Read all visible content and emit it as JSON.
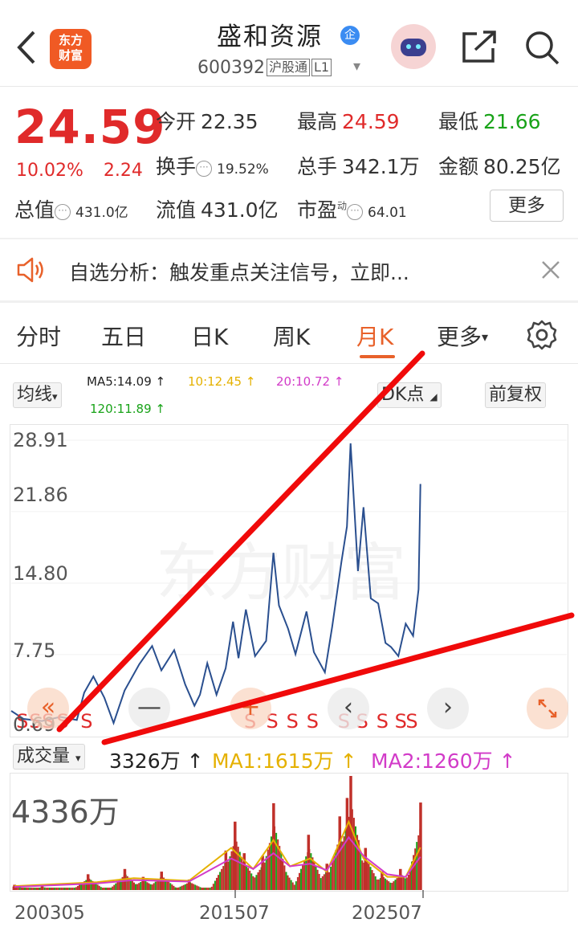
{
  "header": {
    "app_logo": "东方财富",
    "stock_name": "盛和资源",
    "badge": "企",
    "stock_code": "600392",
    "tag_connect": "沪股通",
    "tag_level": "L1",
    "icons": [
      "back-icon",
      "robot-icon",
      "share-icon",
      "search-icon"
    ]
  },
  "quote": {
    "price": "24.59",
    "change_pct": "10.02%",
    "change_abs": "2.24",
    "open_label": "今开",
    "open": "22.35",
    "high_label": "最高",
    "high": "24.59",
    "low_label": "最低",
    "low": "21.66",
    "turnover_label": "换手",
    "turnover": "19.52%",
    "volume_label": "总手",
    "volume": "342.1万",
    "amount_label": "金额",
    "amount": "80.25亿",
    "mktcap_label": "总值",
    "mktcap": "431.0亿",
    "float_label": "流值",
    "float": "431.0亿",
    "pe_label": "市盈",
    "pe_sup": "动",
    "pe": "64.01",
    "more_button": "更多"
  },
  "notice": {
    "text": "自选分析：触发重点关注信号，立即..."
  },
  "tabs": [
    "分时",
    "五日",
    "日K",
    "周K",
    "月K",
    "更多"
  ],
  "active_tab": "月K",
  "chart_controls": {
    "indicator": "均线",
    "ma5": "MA5:14.09",
    "ma10": "10:12.45",
    "ma20": "20:10.72",
    "ma120": "120:11.89",
    "dk_points": "DK点",
    "adjust": "前复权"
  },
  "volume_controls": {
    "indicator": "成交量",
    "vol": "3326万",
    "ma1": "MA1:1615万",
    "ma2": "MA2:1260万",
    "max_label": "4336万"
  },
  "colors": {
    "up": "#e02a2a",
    "down": "#19a319",
    "accent": "#e8612a",
    "price_line": "#2a4f8f"
  },
  "chart_data": {
    "type": "line",
    "title": "",
    "period": "monthly",
    "y_ticks": [
      "28.91",
      "21.86",
      "14.80",
      "7.75",
      "0.69"
    ],
    "ylim": [
      0.69,
      28.91
    ],
    "x_ticks": [
      "200305",
      "201507",
      "202507"
    ],
    "xlim": [
      2003.33,
      2025.7
    ],
    "series": [
      {
        "points": [
          [
            2003.33,
            2.2
          ],
          [
            2004.0,
            1.4
          ],
          [
            2005.0,
            1.2
          ],
          [
            2006.0,
            1.6
          ],
          [
            2006.9,
            1.3
          ],
          [
            2007.3,
            4.0
          ],
          [
            2007.8,
            5.6
          ],
          [
            2008.4,
            3.5
          ],
          [
            2008.9,
            1.0
          ],
          [
            2009.5,
            4.2
          ],
          [
            2010.3,
            6.8
          ],
          [
            2011.0,
            8.6
          ],
          [
            2011.5,
            6.2
          ],
          [
            2012.2,
            8.2
          ],
          [
            2012.8,
            4.8
          ],
          [
            2013.3,
            2.7
          ],
          [
            2013.6,
            3.8
          ],
          [
            2014.0,
            6.9
          ],
          [
            2014.5,
            3.8
          ],
          [
            2015.0,
            6.4
          ],
          [
            2015.4,
            11.0
          ],
          [
            2015.7,
            7.4
          ],
          [
            2016.1,
            12.2
          ],
          [
            2016.6,
            7.6
          ],
          [
            2017.2,
            9.1
          ],
          [
            2017.6,
            17.8
          ],
          [
            2017.9,
            12.6
          ],
          [
            2018.4,
            10.3
          ],
          [
            2018.8,
            7.8
          ],
          [
            2019.4,
            12.0
          ],
          [
            2019.8,
            8.0
          ],
          [
            2020.4,
            6.0
          ],
          [
            2020.8,
            10.5
          ],
          [
            2021.3,
            16.9
          ],
          [
            2021.6,
            20.4
          ],
          [
            2021.8,
            28.6
          ],
          [
            2022.2,
            16.0
          ],
          [
            2022.5,
            22.3
          ],
          [
            2022.9,
            13.3
          ],
          [
            2023.3,
            12.8
          ],
          [
            2023.7,
            8.9
          ],
          [
            2024.0,
            8.5
          ],
          [
            2024.4,
            7.6
          ],
          [
            2024.8,
            10.8
          ],
          [
            2025.2,
            9.6
          ],
          [
            2025.5,
            14.2
          ],
          [
            2025.6,
            24.59
          ]
        ]
      }
    ],
    "volume": {
      "ylim": [
        0,
        4336
      ],
      "latest": 3326,
      "bars": [
        [
          2003.5,
          200
        ],
        [
          2005.0,
          150
        ],
        [
          2007.5,
          600
        ],
        [
          2009.5,
          800
        ],
        [
          2010.5,
          500
        ],
        [
          2011.5,
          700
        ],
        [
          2013.0,
          400
        ],
        [
          2015.0,
          1500
        ],
        [
          2015.5,
          2600
        ],
        [
          2016.0,
          1400
        ],
        [
          2017.0,
          1300
        ],
        [
          2017.6,
          3300
        ],
        [
          2018.0,
          1200
        ],
        [
          2019.5,
          2100
        ],
        [
          2020.5,
          1000
        ],
        [
          2021.2,
          2800
        ],
        [
          2021.6,
          3500
        ],
        [
          2021.8,
          4336
        ],
        [
          2022.2,
          1900
        ],
        [
          2022.6,
          1600
        ],
        [
          2023.5,
          700
        ],
        [
          2024.5,
          800
        ],
        [
          2025.2,
          1100
        ],
        [
          2025.6,
          3326
        ]
      ],
      "ma1": [
        [
          2003.5,
          150
        ],
        [
          2008.0,
          300
        ],
        [
          2010.0,
          450
        ],
        [
          2013.0,
          350
        ],
        [
          2015.3,
          1600
        ],
        [
          2016.5,
          800
        ],
        [
          2017.6,
          1900
        ],
        [
          2018.5,
          900
        ],
        [
          2019.6,
          1200
        ],
        [
          2020.5,
          700
        ],
        [
          2021.7,
          2600
        ],
        [
          2022.5,
          1200
        ],
        [
          2023.8,
          500
        ],
        [
          2024.8,
          500
        ],
        [
          2025.6,
          1615
        ]
      ],
      "ma2": [
        [
          2003.5,
          120
        ],
        [
          2008.0,
          250
        ],
        [
          2010.0,
          380
        ],
        [
          2013.0,
          320
        ],
        [
          2015.3,
          1200
        ],
        [
          2016.5,
          800
        ],
        [
          2017.6,
          1400
        ],
        [
          2018.5,
          900
        ],
        [
          2019.6,
          1000
        ],
        [
          2020.5,
          750
        ],
        [
          2021.7,
          2000
        ],
        [
          2022.5,
          1300
        ],
        [
          2023.8,
          600
        ],
        [
          2024.8,
          500
        ],
        [
          2025.6,
          1260
        ]
      ]
    }
  },
  "annotations": {
    "s_marks": [
      "S",
      "S",
      "S",
      "S",
      "S",
      "S",
      "S",
      "S",
      "S",
      "S",
      "S",
      "S",
      "S",
      "S"
    ]
  }
}
